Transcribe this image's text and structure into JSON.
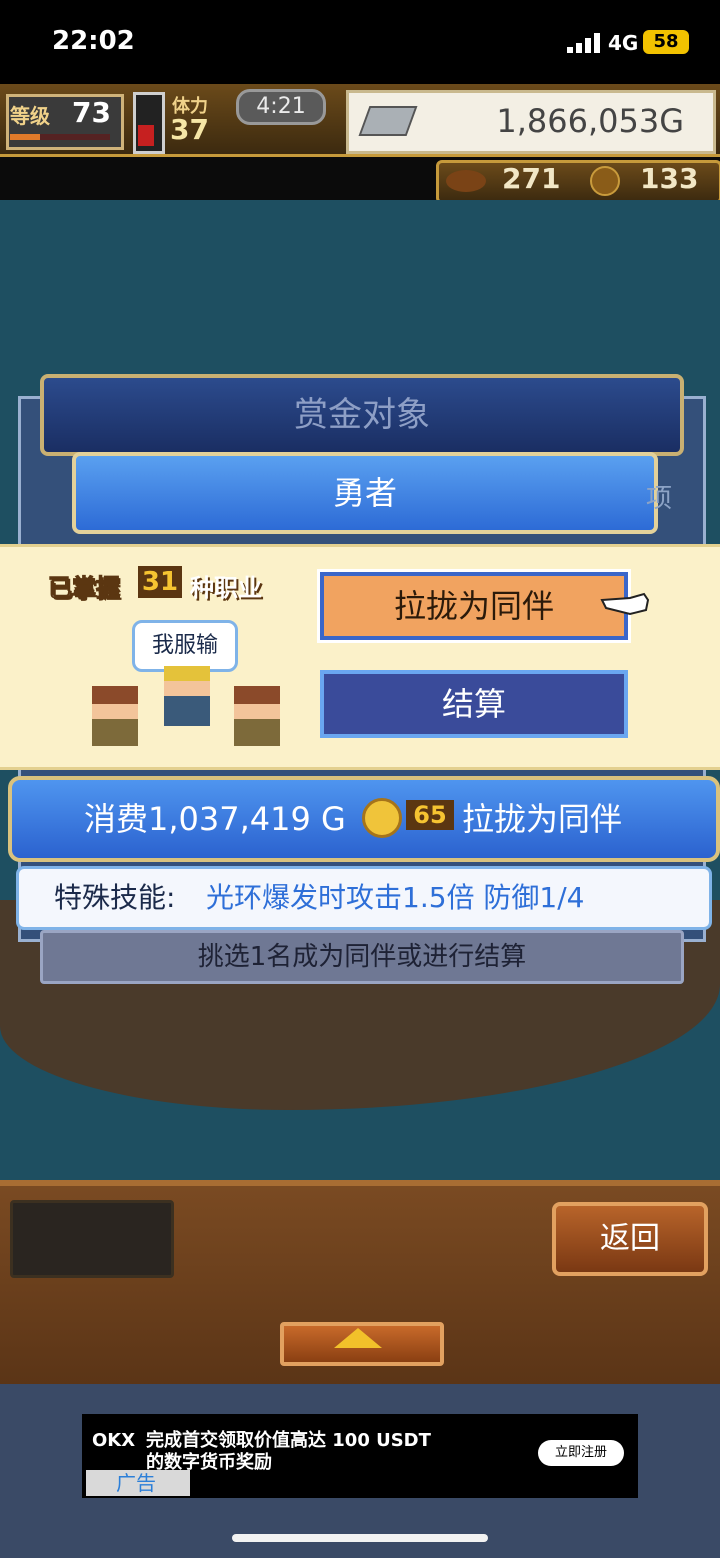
{
  "status_bar": {
    "time": "22:02",
    "network": "4G",
    "battery": "58"
  },
  "hud": {
    "level_label": "等级",
    "level_value": "73",
    "exp_fraction": 0.3,
    "stamina_label": "体力",
    "stamina_value": "37",
    "stamina_fraction": 0.42,
    "timer": "4:21",
    "gold": "1,866,053G",
    "resource1": "271",
    "resource2": "133"
  },
  "dialog": {
    "title": "赏金对象",
    "class_tab": "勇者",
    "side_hint": "项",
    "mastered_prefix": "已掌握",
    "mastered_count": "31",
    "mastered_suffix": "种职业",
    "speech": "我服输",
    "recruit_label": "拉拢为同伴",
    "settle_label": "结算",
    "cost_text": "消费1,037,419 G",
    "coin_count": "65",
    "cost_suffix": "拉拢为同伴",
    "skill_label": "特殊技能:",
    "skill_value": "光环爆发时攻击1.5倍 防御1/4",
    "hint": "挑选1名成为同伴或进行结算"
  },
  "bottom": {
    "back_label": "返回"
  },
  "ad": {
    "logo": "OKX",
    "text": "完成首交领取价值高达 100 USDT 的数字货币奖励",
    "cta": "立即注册",
    "label": "广告"
  },
  "colors": {
    "accent_blue": "#2d6bd6",
    "recruit_orange": "#f1a360",
    "gold": "#f6c431"
  }
}
